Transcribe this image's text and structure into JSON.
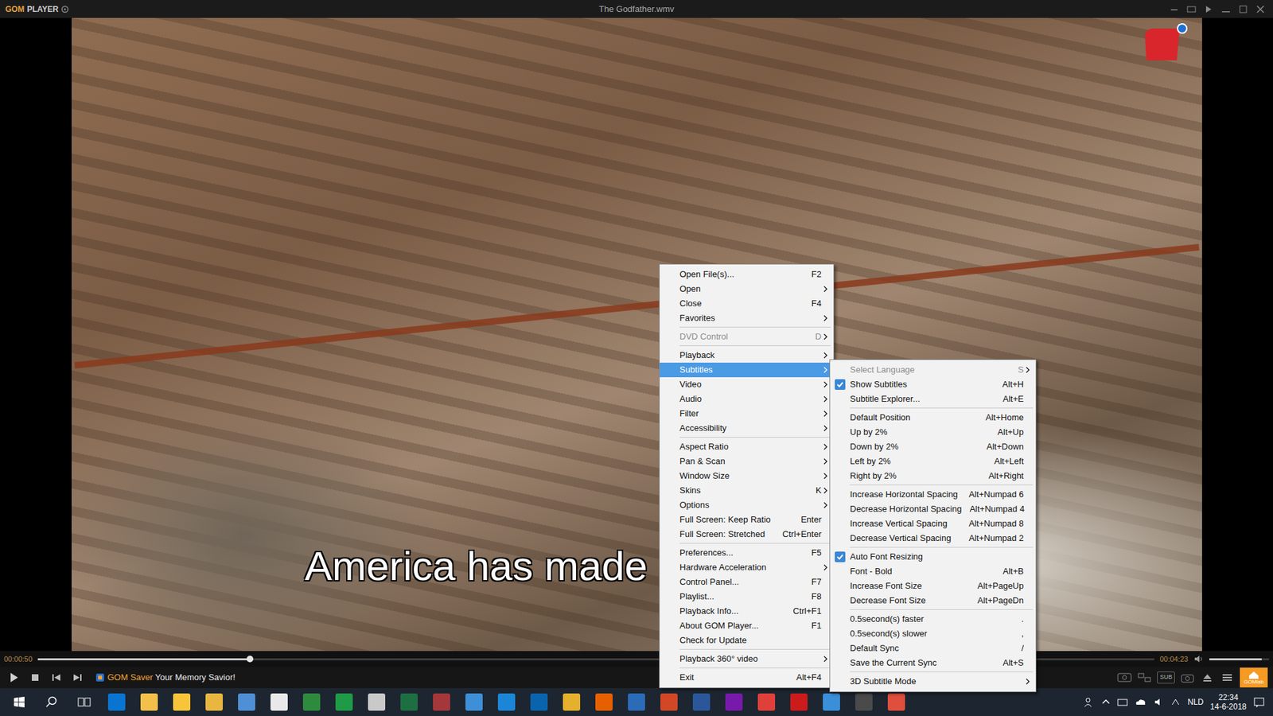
{
  "window": {
    "brand": "GOM",
    "product": "PLAYER",
    "title": "The Godfather.wmv"
  },
  "video": {
    "subtitle": "America has made"
  },
  "seekbar": {
    "elapsed": "00:00:50",
    "total": "00:04:23",
    "level": 0.19,
    "volume": 0.88
  },
  "controls": {
    "saver_brand": "GOM Saver",
    "saver_text": " Your Memory Savior!",
    "sub_button": "SUB",
    "logo": "GOMlab"
  },
  "context_menu": [
    {
      "kind": "item",
      "label": "Open File(s)...",
      "shortcut": "F2",
      "submenu": false,
      "disabled": false,
      "selected": false
    },
    {
      "kind": "item",
      "label": "Open",
      "shortcut": "",
      "submenu": true,
      "disabled": false,
      "selected": false
    },
    {
      "kind": "item",
      "label": "Close",
      "shortcut": "F4",
      "submenu": false,
      "disabled": false,
      "selected": false
    },
    {
      "kind": "item",
      "label": "Favorites",
      "shortcut": "",
      "submenu": true,
      "disabled": false,
      "selected": false
    },
    {
      "kind": "separator"
    },
    {
      "kind": "item",
      "label": "DVD Control",
      "shortcut": "D",
      "submenu": true,
      "disabled": true,
      "selected": false
    },
    {
      "kind": "separator"
    },
    {
      "kind": "item",
      "label": "Playback",
      "shortcut": "",
      "submenu": true,
      "disabled": false,
      "selected": false
    },
    {
      "kind": "item",
      "label": "Subtitles",
      "shortcut": "",
      "submenu": true,
      "disabled": false,
      "selected": true
    },
    {
      "kind": "item",
      "label": "Video",
      "shortcut": "",
      "submenu": true,
      "disabled": false,
      "selected": false
    },
    {
      "kind": "item",
      "label": "Audio",
      "shortcut": "",
      "submenu": true,
      "disabled": false,
      "selected": false
    },
    {
      "kind": "item",
      "label": "Filter",
      "shortcut": "",
      "submenu": true,
      "disabled": false,
      "selected": false
    },
    {
      "kind": "item",
      "label": "Accessibility",
      "shortcut": "",
      "submenu": true,
      "disabled": false,
      "selected": false
    },
    {
      "kind": "separator"
    },
    {
      "kind": "item",
      "label": "Aspect Ratio",
      "shortcut": "",
      "submenu": true,
      "disabled": false,
      "selected": false
    },
    {
      "kind": "item",
      "label": "Pan & Scan",
      "shortcut": "",
      "submenu": true,
      "disabled": false,
      "selected": false
    },
    {
      "kind": "item",
      "label": "Window Size",
      "shortcut": "",
      "submenu": true,
      "disabled": false,
      "selected": false
    },
    {
      "kind": "item",
      "label": "Skins",
      "shortcut": "K",
      "submenu": true,
      "disabled": false,
      "selected": false
    },
    {
      "kind": "item",
      "label": "Options",
      "shortcut": "",
      "submenu": true,
      "disabled": false,
      "selected": false
    },
    {
      "kind": "item",
      "label": "Full Screen: Keep Ratio",
      "shortcut": "Enter",
      "submenu": false,
      "disabled": false,
      "selected": false
    },
    {
      "kind": "item",
      "label": "Full Screen: Stretched",
      "shortcut": "Ctrl+Enter",
      "submenu": false,
      "disabled": false,
      "selected": false
    },
    {
      "kind": "separator"
    },
    {
      "kind": "item",
      "label": "Preferences...",
      "shortcut": "F5",
      "submenu": false,
      "disabled": false,
      "selected": false
    },
    {
      "kind": "item",
      "label": "Hardware Acceleration",
      "shortcut": "",
      "submenu": true,
      "disabled": false,
      "selected": false
    },
    {
      "kind": "item",
      "label": "Control Panel...",
      "shortcut": "F7",
      "submenu": false,
      "disabled": false,
      "selected": false
    },
    {
      "kind": "item",
      "label": "Playlist...",
      "shortcut": "F8",
      "submenu": false,
      "disabled": false,
      "selected": false
    },
    {
      "kind": "item",
      "label": "Playback Info...",
      "shortcut": "Ctrl+F1",
      "submenu": false,
      "disabled": false,
      "selected": false
    },
    {
      "kind": "item",
      "label": "About GOM Player...",
      "shortcut": "F1",
      "submenu": false,
      "disabled": false,
      "selected": false
    },
    {
      "kind": "item",
      "label": "Check for Update",
      "shortcut": "",
      "submenu": false,
      "disabled": false,
      "selected": false
    },
    {
      "kind": "separator"
    },
    {
      "kind": "item",
      "label": "Playback 360° video",
      "shortcut": "",
      "submenu": true,
      "disabled": false,
      "selected": false
    },
    {
      "kind": "separator"
    },
    {
      "kind": "item",
      "label": "Exit",
      "shortcut": "Alt+F4",
      "submenu": false,
      "disabled": false,
      "selected": false
    }
  ],
  "subtitles_menu": [
    {
      "kind": "item",
      "label": "Select Language",
      "shortcut": "S",
      "submenu": true,
      "disabled": true,
      "checked": false,
      "selected": false
    },
    {
      "kind": "item",
      "label": "Show Subtitles",
      "shortcut": "Alt+H",
      "submenu": false,
      "disabled": false,
      "checked": true,
      "selected": false
    },
    {
      "kind": "item",
      "label": "Subtitle Explorer...",
      "shortcut": "Alt+E",
      "submenu": false,
      "disabled": false,
      "checked": false,
      "selected": false
    },
    {
      "kind": "separator"
    },
    {
      "kind": "item",
      "label": "Default Position",
      "shortcut": "Alt+Home",
      "submenu": false,
      "disabled": false,
      "checked": false,
      "selected": false
    },
    {
      "kind": "item",
      "label": "Up by 2%",
      "shortcut": "Alt+Up",
      "submenu": false,
      "disabled": false,
      "checked": false,
      "selected": false
    },
    {
      "kind": "item",
      "label": "Down by 2%",
      "shortcut": "Alt+Down",
      "submenu": false,
      "disabled": false,
      "checked": false,
      "selected": false
    },
    {
      "kind": "item",
      "label": "Left by 2%",
      "shortcut": "Alt+Left",
      "submenu": false,
      "disabled": false,
      "checked": false,
      "selected": false
    },
    {
      "kind": "item",
      "label": "Right by 2%",
      "shortcut": "Alt+Right",
      "submenu": false,
      "disabled": false,
      "checked": false,
      "selected": false
    },
    {
      "kind": "separator"
    },
    {
      "kind": "item",
      "label": "Increase Horizontal Spacing",
      "shortcut": "Alt+Numpad 6",
      "submenu": false,
      "disabled": false,
      "checked": false,
      "selected": false
    },
    {
      "kind": "item",
      "label": "Decrease Horizontal Spacing",
      "shortcut": "Alt+Numpad 4",
      "submenu": false,
      "disabled": false,
      "checked": false,
      "selected": false
    },
    {
      "kind": "item",
      "label": "Increase Vertical Spacing",
      "shortcut": "Alt+Numpad 8",
      "submenu": false,
      "disabled": false,
      "checked": false,
      "selected": false
    },
    {
      "kind": "item",
      "label": "Decrease Vertical Spacing",
      "shortcut": "Alt+Numpad 2",
      "submenu": false,
      "disabled": false,
      "checked": false,
      "selected": false
    },
    {
      "kind": "separator"
    },
    {
      "kind": "item",
      "label": "Auto Font Resizing",
      "shortcut": "",
      "submenu": false,
      "disabled": false,
      "checked": true,
      "selected": false
    },
    {
      "kind": "item",
      "label": "Font - Bold",
      "shortcut": "Alt+B",
      "submenu": false,
      "disabled": false,
      "checked": false,
      "selected": false
    },
    {
      "kind": "item",
      "label": "Increase Font Size",
      "shortcut": "Alt+PageUp",
      "submenu": false,
      "disabled": false,
      "checked": false,
      "selected": false
    },
    {
      "kind": "item",
      "label": "Decrease Font Size",
      "shortcut": "Alt+PageDn",
      "submenu": false,
      "disabled": false,
      "checked": false,
      "selected": false
    },
    {
      "kind": "separator"
    },
    {
      "kind": "item",
      "label": "0.5second(s) faster",
      "shortcut": ".",
      "submenu": false,
      "disabled": false,
      "checked": false,
      "selected": false
    },
    {
      "kind": "item",
      "label": "0.5second(s) slower",
      "shortcut": ",",
      "submenu": false,
      "disabled": false,
      "checked": false,
      "selected": false
    },
    {
      "kind": "item",
      "label": "Default Sync",
      "shortcut": "/",
      "submenu": false,
      "disabled": false,
      "checked": false,
      "selected": false
    },
    {
      "kind": "item",
      "label": "Save the Current Sync",
      "shortcut": "Alt+S",
      "submenu": false,
      "disabled": false,
      "checked": false,
      "selected": false
    },
    {
      "kind": "separator"
    },
    {
      "kind": "item",
      "label": "3D Subtitle Mode",
      "shortcut": "",
      "submenu": true,
      "disabled": false,
      "checked": false,
      "selected": false
    }
  ],
  "taskbar": {
    "apps": [
      {
        "color": "#0a74d1"
      },
      {
        "color": "#f3c14a"
      },
      {
        "color": "#f8c53a"
      },
      {
        "color": "#e9b640"
      },
      {
        "color": "#4f8fd6"
      },
      {
        "color": "#e9e9e9"
      },
      {
        "color": "#2e8b3e"
      },
      {
        "color": "#1f9a47"
      },
      {
        "color": "#c9c9c9"
      },
      {
        "color": "#1d6f42"
      },
      {
        "color": "#a4373a"
      },
      {
        "color": "#3d8fd8"
      },
      {
        "color": "#1b86d8"
      },
      {
        "color": "#0a64ad"
      },
      {
        "color": "#e4b02e"
      },
      {
        "color": "#e66000"
      },
      {
        "color": "#2b6bb8"
      },
      {
        "color": "#d24726"
      },
      {
        "color": "#2b579a"
      },
      {
        "color": "#7719aa"
      },
      {
        "color": "#e0403a"
      },
      {
        "color": "#cc1b1b"
      },
      {
        "color": "#3b8ed8"
      },
      {
        "color": "#4a4a4a"
      },
      {
        "color": "#e04f3d"
      }
    ],
    "language": "NLD",
    "time": "22:34",
    "date": "14-6-2018"
  }
}
